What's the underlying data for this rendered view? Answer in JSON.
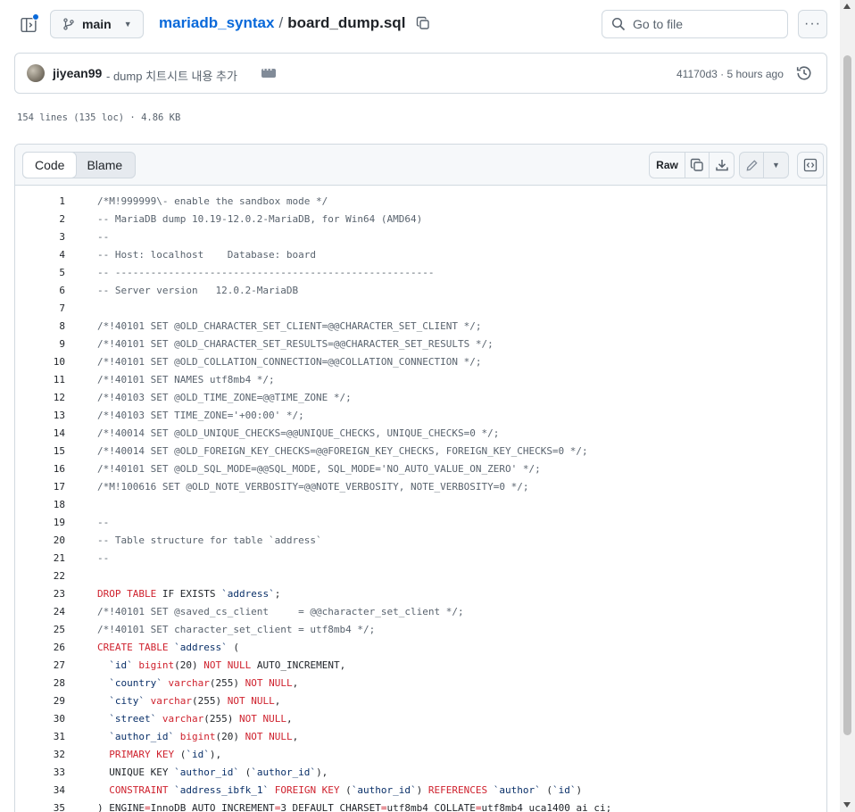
{
  "header": {
    "branch": "main",
    "repo": "mariadb_syntax",
    "separator": "/",
    "file": "board_dump.sql",
    "goto_placeholder": "Go to file",
    "icons": [
      "sidebar-icon",
      "git-branch-icon",
      "copy-icon",
      "search-icon",
      "kebab-icon"
    ]
  },
  "commit": {
    "author": "jiyean99",
    "message": "- dump 치트시트 내용 추가",
    "sha_time": "41170d3 · 5 hours ago"
  },
  "file_info": "154 lines (135 loc) · 4.86 KB",
  "toolbar": {
    "code_tab": "Code",
    "blame_tab": "Blame",
    "raw_label": "Raw"
  },
  "colors": {
    "accent": "#0969da",
    "keyword": "#cf222e",
    "comment": "#59636e",
    "ident": "#0a3069"
  },
  "code_lines": [
    {
      "n": "1",
      "t": [
        [
          "c",
          "/*M!999999\\- enable the sandbox mode */"
        ]
      ]
    },
    {
      "n": "2",
      "t": [
        [
          "c",
          "-- MariaDB dump 10.19-12.0.2-MariaDB, for Win64 (AMD64)"
        ]
      ]
    },
    {
      "n": "3",
      "t": [
        [
          "c",
          "--"
        ]
      ]
    },
    {
      "n": "4",
      "t": [
        [
          "c",
          "-- Host: localhost    Database: board"
        ]
      ]
    },
    {
      "n": "5",
      "t": [
        [
          "c",
          "-- ------------------------------------------------------"
        ]
      ]
    },
    {
      "n": "6",
      "t": [
        [
          "c",
          "-- Server version   12.0.2-MariaDB"
        ]
      ]
    },
    {
      "n": "7",
      "t": []
    },
    {
      "n": "8",
      "t": [
        [
          "c",
          "/*!40101 SET @OLD_CHARACTER_SET_CLIENT=@@CHARACTER_SET_CLIENT */;"
        ]
      ]
    },
    {
      "n": "9",
      "t": [
        [
          "c",
          "/*!40101 SET @OLD_CHARACTER_SET_RESULTS=@@CHARACTER_SET_RESULTS */;"
        ]
      ]
    },
    {
      "n": "10",
      "t": [
        [
          "c",
          "/*!40101 SET @OLD_COLLATION_CONNECTION=@@COLLATION_CONNECTION */;"
        ]
      ]
    },
    {
      "n": "11",
      "t": [
        [
          "c",
          "/*!40101 SET NAMES utf8mb4 */;"
        ]
      ]
    },
    {
      "n": "12",
      "t": [
        [
          "c",
          "/*!40103 SET @OLD_TIME_ZONE=@@TIME_ZONE */;"
        ]
      ]
    },
    {
      "n": "13",
      "t": [
        [
          "c",
          "/*!40103 SET TIME_ZONE='+00:00' */;"
        ]
      ]
    },
    {
      "n": "14",
      "t": [
        [
          "c",
          "/*!40014 SET @OLD_UNIQUE_CHECKS=@@UNIQUE_CHECKS, UNIQUE_CHECKS=0 */;"
        ]
      ]
    },
    {
      "n": "15",
      "t": [
        [
          "c",
          "/*!40014 SET @OLD_FOREIGN_KEY_CHECKS=@@FOREIGN_KEY_CHECKS, FOREIGN_KEY_CHECKS=0 */;"
        ]
      ]
    },
    {
      "n": "16",
      "t": [
        [
          "c",
          "/*!40101 SET @OLD_SQL_MODE=@@SQL_MODE, SQL_MODE='NO_AUTO_VALUE_ON_ZERO' */;"
        ]
      ]
    },
    {
      "n": "17",
      "t": [
        [
          "c",
          "/*M!100616 SET @OLD_NOTE_VERBOSITY=@@NOTE_VERBOSITY, NOTE_VERBOSITY=0 */;"
        ]
      ]
    },
    {
      "n": "18",
      "t": []
    },
    {
      "n": "19",
      "t": [
        [
          "c",
          "--"
        ]
      ]
    },
    {
      "n": "20",
      "t": [
        [
          "c",
          "-- Table structure for table `address`"
        ]
      ]
    },
    {
      "n": "21",
      "t": [
        [
          "c",
          "--"
        ]
      ]
    },
    {
      "n": "22",
      "t": []
    },
    {
      "n": "23",
      "t": [
        [
          "k",
          "DROP TABLE"
        ],
        [
          "x",
          " IF EXISTS "
        ],
        [
          "i",
          "`address`"
        ],
        [
          "x",
          ";"
        ]
      ]
    },
    {
      "n": "24",
      "t": [
        [
          "c",
          "/*!40101 SET @saved_cs_client     = @@character_set_client */;"
        ]
      ]
    },
    {
      "n": "25",
      "t": [
        [
          "c",
          "/*!40101 SET character_set_client = utf8mb4 */;"
        ]
      ]
    },
    {
      "n": "26",
      "t": [
        [
          "k",
          "CREATE TABLE"
        ],
        [
          "x",
          " "
        ],
        [
          "i",
          "`address`"
        ],
        [
          "x",
          " ("
        ]
      ]
    },
    {
      "n": "27",
      "t": [
        [
          "x",
          "  "
        ],
        [
          "i",
          "`id`"
        ],
        [
          "x",
          " "
        ],
        [
          "k",
          "bigint"
        ],
        [
          "x",
          "(20) "
        ],
        [
          "k",
          "NOT NULL"
        ],
        [
          "x",
          " AUTO_INCREMENT,"
        ]
      ]
    },
    {
      "n": "28",
      "t": [
        [
          "x",
          "  "
        ],
        [
          "i",
          "`country`"
        ],
        [
          "x",
          " "
        ],
        [
          "k",
          "varchar"
        ],
        [
          "x",
          "(255) "
        ],
        [
          "k",
          "NOT NULL"
        ],
        [
          "x",
          ","
        ]
      ]
    },
    {
      "n": "29",
      "t": [
        [
          "x",
          "  "
        ],
        [
          "i",
          "`city`"
        ],
        [
          "x",
          " "
        ],
        [
          "k",
          "varchar"
        ],
        [
          "x",
          "(255) "
        ],
        [
          "k",
          "NOT NULL"
        ],
        [
          "x",
          ","
        ]
      ]
    },
    {
      "n": "30",
      "t": [
        [
          "x",
          "  "
        ],
        [
          "i",
          "`street`"
        ],
        [
          "x",
          " "
        ],
        [
          "k",
          "varchar"
        ],
        [
          "x",
          "(255) "
        ],
        [
          "k",
          "NOT NULL"
        ],
        [
          "x",
          ","
        ]
      ]
    },
    {
      "n": "31",
      "t": [
        [
          "x",
          "  "
        ],
        [
          "i",
          "`author_id`"
        ],
        [
          "x",
          " "
        ],
        [
          "k",
          "bigint"
        ],
        [
          "x",
          "(20) "
        ],
        [
          "k",
          "NOT NULL"
        ],
        [
          "x",
          ","
        ]
      ]
    },
    {
      "n": "32",
      "t": [
        [
          "x",
          "  "
        ],
        [
          "k",
          "PRIMARY KEY"
        ],
        [
          "x",
          " ("
        ],
        [
          "i",
          "`id`"
        ],
        [
          "x",
          "),"
        ]
      ]
    },
    {
      "n": "33",
      "t": [
        [
          "x",
          "  UNIQUE KEY "
        ],
        [
          "i",
          "`author_id`"
        ],
        [
          "x",
          " ("
        ],
        [
          "i",
          "`author_id`"
        ],
        [
          "x",
          "),"
        ]
      ]
    },
    {
      "n": "34",
      "t": [
        [
          "x",
          "  "
        ],
        [
          "k",
          "CONSTRAINT"
        ],
        [
          "x",
          " "
        ],
        [
          "i",
          "`address_ibfk_1`"
        ],
        [
          "x",
          " "
        ],
        [
          "k",
          "FOREIGN KEY"
        ],
        [
          "x",
          " ("
        ],
        [
          "i",
          "`author_id`"
        ],
        [
          "x",
          ") "
        ],
        [
          "k",
          "REFERENCES"
        ],
        [
          "x",
          " "
        ],
        [
          "i",
          "`author`"
        ],
        [
          "x",
          " ("
        ],
        [
          "i",
          "`id`"
        ],
        [
          "x",
          ")"
        ]
      ]
    },
    {
      "n": "35",
      "t": [
        [
          "x",
          ") ENGINE"
        ],
        [
          "k",
          "="
        ],
        [
          "x",
          "InnoDB AUTO_INCREMENT"
        ],
        [
          "k",
          "="
        ],
        [
          "x",
          "3 DEFAULT CHARSET"
        ],
        [
          "k",
          "="
        ],
        [
          "x",
          "utf8mb4 COLLATE"
        ],
        [
          "k",
          "="
        ],
        [
          "x",
          "utf8mb4_uca1400_ai_ci;"
        ]
      ]
    }
  ]
}
